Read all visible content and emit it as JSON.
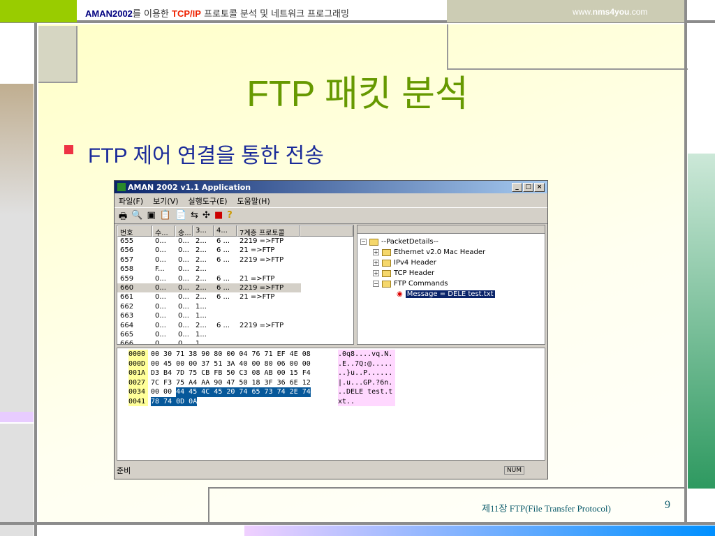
{
  "header": {
    "brand": "AMAN2002",
    "text1": "를 이용한 ",
    "tcpip": "TCP/IP",
    "text2": " 프로토콜 분석 및 네트워크 프로그래밍",
    "url_pre": "www.",
    "url_bold": "nms4you",
    "url_post": ".com"
  },
  "title": "FTP 패킷 분석",
  "bullet": "FTP 제어 연결을 통한 전송",
  "app": {
    "title": "AMAN 2002 v1.1 Application",
    "menu": [
      "파일(F)",
      "보기(V)",
      "실행도구(E)",
      "도움말(H)"
    ],
    "columns": [
      "번호",
      "수...",
      "송...",
      "3...",
      "4...",
      "7계층 프로토콜"
    ],
    "rows": [
      [
        "655",
        "0...",
        "0...",
        "2...",
        "6 ...",
        "2219 =>FTP"
      ],
      [
        "656",
        "0...",
        "0...",
        "2...",
        "6 ...",
        "21 =>FTP"
      ],
      [
        "657",
        "0...",
        "0...",
        "2...",
        "6 ...",
        "2219 =>FTP"
      ],
      [
        "658",
        "F...",
        "0...",
        "2...",
        "",
        ""
      ],
      [
        "659",
        "0...",
        "0...",
        "2...",
        "6 ...",
        "21 =>FTP"
      ],
      [
        "660",
        "0...",
        "0...",
        "2...",
        "6 ...",
        "2219 =>FTP"
      ],
      [
        "661",
        "0...",
        "0...",
        "2...",
        "6 ...",
        "21 =>FTP"
      ],
      [
        "662",
        "0...",
        "0...",
        "1...",
        "",
        ""
      ],
      [
        "663",
        "0...",
        "0...",
        "1...",
        "",
        ""
      ],
      [
        "664",
        "0...",
        "0...",
        "2...",
        "6 ...",
        "2219 =>FTP"
      ],
      [
        "665",
        "0...",
        "0...",
        "1...",
        "",
        ""
      ],
      [
        "666",
        "0...",
        "0...",
        "1...",
        "",
        ""
      ]
    ],
    "tree": {
      "root": "--PacketDetails--",
      "items": [
        "Ethernet v2.0 Mac Header",
        "IPv4 Header",
        "TCP Header",
        "FTP Commands"
      ],
      "leaf": "Message = DELE test.txt"
    },
    "hex": [
      {
        "off": "0000",
        "plain": "00 30 71 38 90 80 00 04 76 71 EF 4E 08",
        "sel": "",
        "ascii": ".0q8....vq.N."
      },
      {
        "off": "000D",
        "plain": "00 45 00 00 37 51 3A 40 00 80 06 00 00",
        "sel": "",
        "ascii": ".E..7Q:@....."
      },
      {
        "off": "001A",
        "plain": "D3 B4 7D 75 CB FB 50 C3 08 AB 00 15 F4",
        "sel": "",
        "ascii": "..}u..P......"
      },
      {
        "off": "0027",
        "plain": "7C F3 75 A4 AA 90 47 50 18 3F 36 6E 12",
        "sel": "",
        "ascii": "|.u...GP.?6n."
      },
      {
        "off": "0034",
        "plain": "00 00 ",
        "sel": "44 45 4C 45 20 74 65 73 74 2E 74",
        "ascii": "..DELE test.t"
      },
      {
        "off": "0041",
        "plain": "",
        "sel": "78 74 0D 0A",
        "ascii": "xt.."
      }
    ],
    "status": "준비",
    "num": "NUM"
  },
  "footer": {
    "chapter": "제11장 FTP(File Transfer Protocol)",
    "page": "9"
  }
}
